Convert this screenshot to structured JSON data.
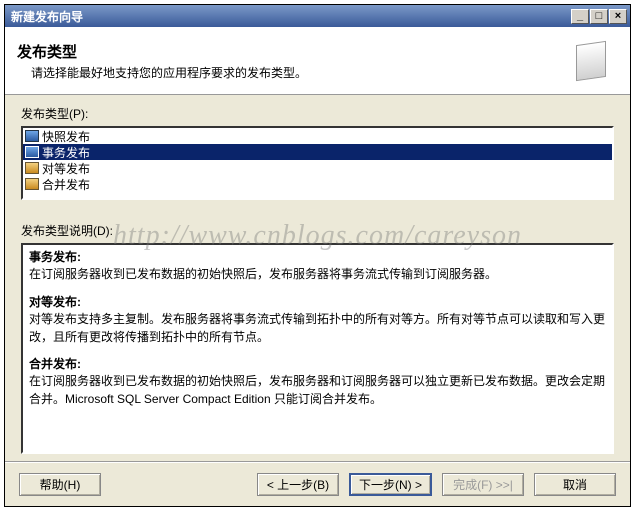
{
  "window": {
    "title": "新建发布向导",
    "ctrl_min": "_",
    "ctrl_max": "□",
    "ctrl_close": "×"
  },
  "header": {
    "title": "发布类型",
    "subtitle": "请选择能最好地支持您的应用程序要求的发布类型。"
  },
  "list_label": "发布类型(P):",
  "publication_types": [
    {
      "label": "快照发布",
      "selected": false
    },
    {
      "label": "事务发布",
      "selected": true
    },
    {
      "label": "对等发布",
      "selected": false
    },
    {
      "label": "合并发布",
      "selected": false
    }
  ],
  "desc_label": "发布类型说明(D):",
  "descriptions": {
    "d1_title": "事务发布:",
    "d1_body": "在订阅服务器收到已发布数据的初始快照后，发布服务器将事务流式传输到订阅服务器。",
    "d2_title": "对等发布:",
    "d2_body": "对等发布支持多主复制。发布服务器将事务流式传输到拓扑中的所有对等方。所有对等节点可以读取和写入更改，且所有更改将传播到拓扑中的所有节点。",
    "d3_title": "合并发布:",
    "d3_body": "在订阅服务器收到已发布数据的初始快照后，发布服务器和订阅服务器可以独立更新已发布数据。更改会定期合并。Microsoft SQL Server Compact Edition 只能订阅合并发布。"
  },
  "buttons": {
    "help": "帮助(H)",
    "back": "< 上一步(B)",
    "next": "下一步(N) >",
    "finish": "完成(F) >>|",
    "cancel": "取消"
  },
  "watermark": "http://www.cnblogs.com/careyson"
}
